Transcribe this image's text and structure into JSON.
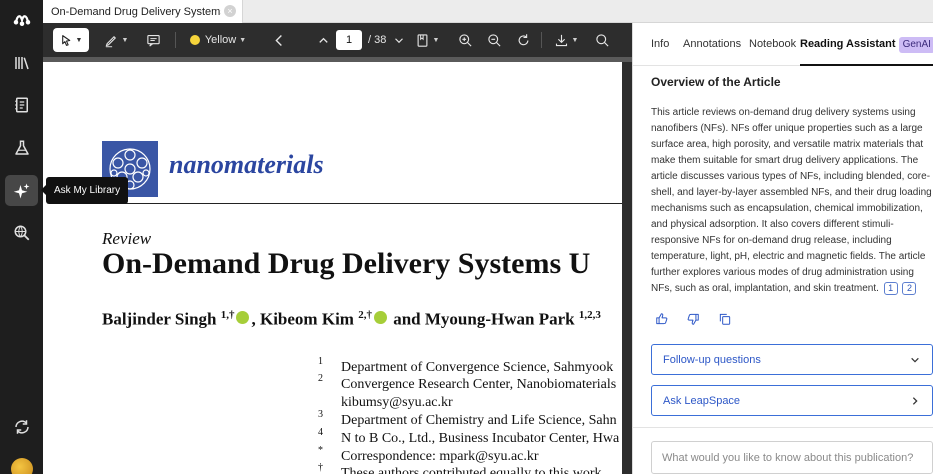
{
  "tab": {
    "title": "On-Demand Drug Delivery Systems U...",
    "close_glyph": "×"
  },
  "rail": {
    "items": [
      {
        "icon": "library-icon"
      },
      {
        "icon": "notebook-icon"
      },
      {
        "icon": "flask-icon"
      },
      {
        "icon": "sparkle-icon",
        "active": true
      },
      {
        "icon": "search-globe-icon"
      },
      {
        "icon": "sync-icon"
      }
    ],
    "tooltip": "Ask My Library"
  },
  "toolbar": {
    "highlight_color_label": "Yellow",
    "highlight_color": "#f5d43b",
    "page_current": "1",
    "page_total": "/ 38"
  },
  "document": {
    "journal": "nanomaterials",
    "article_type": "Review",
    "title": "On-Demand Drug Delivery Systems U",
    "authors": [
      {
        "name": "Baljinder Singh",
        "sup": "1,†"
      },
      {
        "name": "Kibeom Kim",
        "sup": "2,†"
      },
      {
        "name": "Myoung-Hwan Park",
        "sup": "1,2,3"
      }
    ],
    "authors_sep": ",",
    "authors_and": "and",
    "affiliations": [
      {
        "num": "1",
        "text": "Department of Convergence Science, Sahmyook"
      },
      {
        "num": "2",
        "text": "Convergence Research Center, Nanobiomaterials"
      },
      {
        "num": "",
        "text": "kibumsy@syu.ac.kr"
      },
      {
        "num": "3",
        "text": "Department of Chemistry and Life Science, Sahn"
      },
      {
        "num": "4",
        "text": "N to B Co., Ltd., Business Incubator Center, Hwa"
      },
      {
        "num": "*",
        "text": "Correspondence: mpark@syu.ac.kr"
      },
      {
        "num": "†",
        "text": "These authors contributed equally to this work"
      }
    ]
  },
  "panel": {
    "tabs": [
      {
        "label": "Info"
      },
      {
        "label": "Annotations"
      },
      {
        "label": "Notebook"
      },
      {
        "label": "Reading Assistant",
        "badge": "GenAI",
        "active": true
      }
    ],
    "overview_title": "Overview of the Article",
    "summary": "This article reviews on-demand drug delivery systems using nanofibers (NFs). NFs offer unique properties such as a large surface area, high porosity, and versatile matrix materials that make them suitable for smart drug delivery applications. The article discusses various types of NFs, including blended, core-shell, and layer-by-layer assembled NFs, and their drug loading mechanisms such as encapsulation, chemical immobilization, and physical adsorption. It also covers different stimuli-responsive NFs for on-demand drug release, including temperature, light, pH, electric and magnetic fields. The article further explores various modes of drug administration using NFs, such as oral, implantation, and skin treatment.",
    "citations": [
      "1",
      "2"
    ],
    "followup_label": "Follow-up questions",
    "leapspace_label": "Ask LeapSpace",
    "ask_placeholder": "What would you like to know about this publication?",
    "accent_color": "#3b6fd8"
  }
}
